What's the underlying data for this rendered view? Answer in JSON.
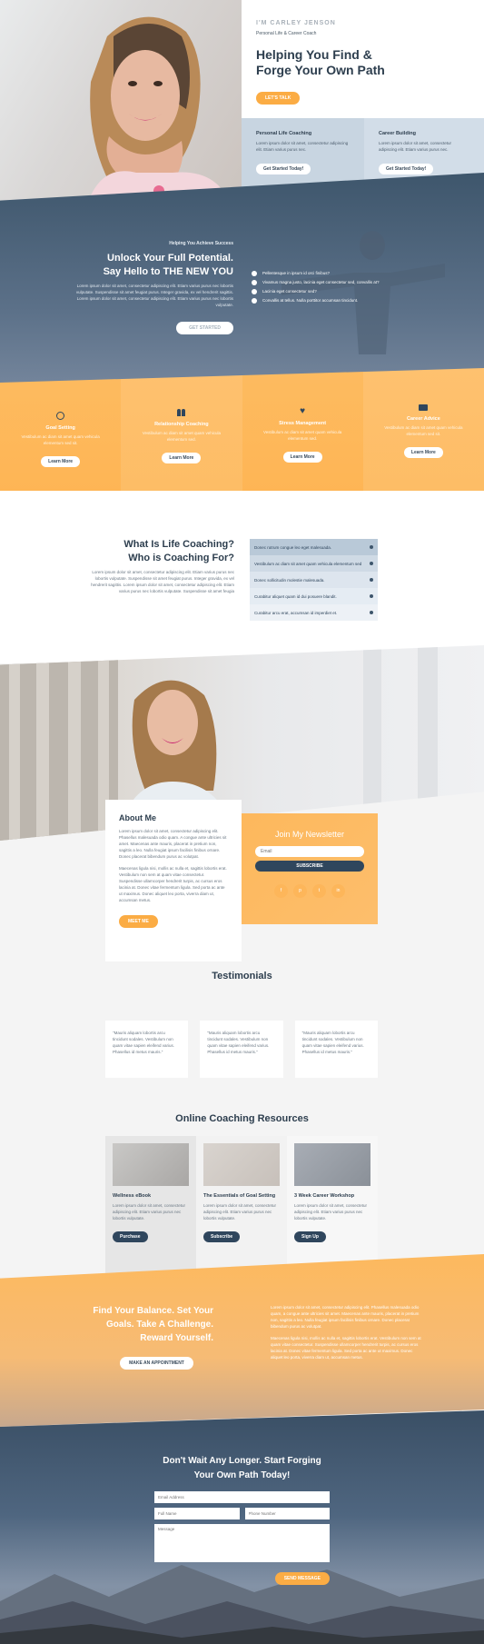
{
  "hero": {
    "eyebrow": "I'M CARLEY JENSON",
    "subtitle": "Personal Life & Career Coach",
    "title": "Helping You Find & Forge Your Own Path",
    "cta": "LET'S TALK",
    "card1": {
      "title": "Personal Life Coaching",
      "text": "Lorem ipsum dolor sit amet, consectetur adipiscing elit. Etiam varius purus nec.",
      "button": "Get Started Today!"
    },
    "card2": {
      "title": "Career Building",
      "text": "Lorem ipsum dolor sit amet, consectetur adipiscing elit. Etiam varius purus nec.",
      "button": "Get Started Today!"
    }
  },
  "potential": {
    "eyebrow": "Helping You Achieve Success",
    "title_line1": "Unlock Your Full Potential.",
    "title_line2": "Say Hello to THE NEW YOU",
    "text": "Lorem ipsum dolor sit amet, consectetur adipiscing elit. Etiam varius purus nec lobortis vulputate. Suspendisse sit amet feugiat purus. Integer gravida, ex vel hendrerit sagittis. Lorem ipsum dolor sit amet, consectetur adipiscing elit. Etiam varius purus nec lobortis vulputate.",
    "button": "GET STARTED",
    "checks": [
      "Pellentesque in ipsum id orci finibus?",
      "Vivamus magna justo, lacinia eget consectetur sed, convallis at?",
      "Lacinia eget consectetur sed?",
      "Convallis at tellus. Nulla porttitor accumsan tincidunt."
    ]
  },
  "features": [
    {
      "icon": "target-icon",
      "title": "Goal Setting",
      "text": "Vestibulum ac diam sit amet quam vehicula elementum sed sit.",
      "button": "Learn More"
    },
    {
      "icon": "people-icon",
      "title": "Relationship Coaching",
      "text": "Vestibulum ac diam sit amet quam vehicula elementum sed.",
      "button": "Learn More"
    },
    {
      "icon": "heart-icon",
      "title": "Stress Management",
      "text": "Vestibulum ac diam sit amet quam vehicula elementum sed.",
      "button": "Learn More"
    },
    {
      "icon": "briefcase-icon",
      "title": "Career Advice",
      "text": "Vestibulum ac diam sit amet quam vehicula elementum sed sit.",
      "button": "Learn More"
    }
  ],
  "coaching": {
    "title_line1": "What Is Life Coaching?",
    "title_line2": "Who is Coaching For?",
    "text": "Lorem ipsum dolor sit amet, consectetur adipiscing elit. Etiam varius purus nec lobortis vulputate. Suspendisse sit amet feugiat purus. Integer gravida, ex vel hendrerit sagittis. Lorem ipsum dolor sit amet, consectetur adipiscing elit. Etiam varius purus nec lobortis vulputate. Suspendisse sit amet feugia",
    "faq": [
      "Donec rutrum congue leo eget malesuada.",
      "Vestibulum ac diam sit amet quam vehicula elementum sed",
      "Donec sollicitudin molestie malesuada.",
      "Curabitur aliquet quam id dui posuere blandit.",
      "Curabitur arcu erat, accumsan id imperdiet et."
    ]
  },
  "about": {
    "title": "About Me",
    "p1": "Lorem ipsum dolor sit amet, consectetur adipiscing elit. Phasellus malesuada odio quam. A congue ante ultricies sit amet. Maecenas ante mauris, placerat in pretium non, sagittis a leo. Nulla feugiat ipsum facilisis finibus ornare. Donec placerat bibendum purus ac volutpat.",
    "p2": "Maecenas ligula nisi, mollis ac nulla et, sagittis lobortis erat. Vestibulum non sem at quam vitae consectetur. Suspendisse ullamcorper hendrerit turpis, ac cursus eros lacinia at. Donec vitae fermentum ligula. Sed porta ac ante ut maximus. Donec aliquet leo porta, viverra diam ut, accumsan metus.",
    "button": "MEET ME"
  },
  "newsletter": {
    "title": "Join My Newsletter",
    "email_placeholder": "Email",
    "button": "SUBSCRIBE",
    "socials": [
      "f",
      "p",
      "t",
      "in"
    ]
  },
  "testimonials": {
    "title": "Testimonials",
    "items": [
      "\"Mauris aliquam lobortis arcu tincidunt sodales. Vestibulum non quam vitae sapien eleifend varius. Phasellus id metus mauris.\"",
      "\"Mauris aliquam lobortis arcu tincidunt sodales. Vestibulum non quam vitae sapien eleifend varius. Phasellus id metus mauris.\"",
      "\"Mauris aliquam lobortis arcu tincidunt sodales. Vestibulum non quam vitae sapien eleifend varius. Phasellus id metus mauris.\""
    ]
  },
  "resources": {
    "title": "Online Coaching Resources",
    "items": [
      {
        "title": "Wellness eBook",
        "text": "Lorem ipsum dolor sit amet, consectetur adipiscing elit. Etiam varius purus nec lobortis vulputate.",
        "button": "Purchase"
      },
      {
        "title": "The Essentials of Goal Setting",
        "text": "Lorem ipsum dolor sit amet, consectetur adipiscing elit. Etiam varius purus nec lobortis vulputate.",
        "button": "Subscribe"
      },
      {
        "title": "3 Week Career Workshop",
        "text": "Lorem ipsum dolor sit amet, consectetur adipiscing elit. Etiam varius purus nec lobortis vulputate.",
        "button": "Sign Up"
      }
    ]
  },
  "balance": {
    "title_line1": "Find Your Balance. Set Your",
    "title_line2": "Goals. Take A Challenge.",
    "title_line3": "Reward Yourself.",
    "button": "MAKE AN APPOINTMENT",
    "p1": "Lorem ipsum dolor sit amet, consectetur adipiscing elit. Phasellus malesuada odio quam, a congue ante ultricies sit amet. Maecenas ante mauris, placerat in pretium non, sagittis a leo. Nulla feugiat ipsum facilisis finibus ornare. Donec placerat bibendum purus ac volutpat.",
    "p2": "Maecenas ligula nisi, mollis ac nulla et, sagittis lobortis erat. Vestibulum non sem at quam vitae consectetur. Suspendisse ullamcorper hendrerit turpis, ac cursus eros lacinia at. Donec vitae fermentum ligula. Sed porta ac ante ut maximus. Donec aliquet leo porta, viverra diam ut, accumsan metus."
  },
  "contact": {
    "title_line1": "Don't Wait Any Longer. Start Forging",
    "title_line2": "Your Own Path Today!",
    "email_placeholder": "Email Address",
    "name_placeholder": "Full Name",
    "phone_placeholder": "Phone Number",
    "message_placeholder": "Message",
    "button": "SEND MESSAGE"
  }
}
